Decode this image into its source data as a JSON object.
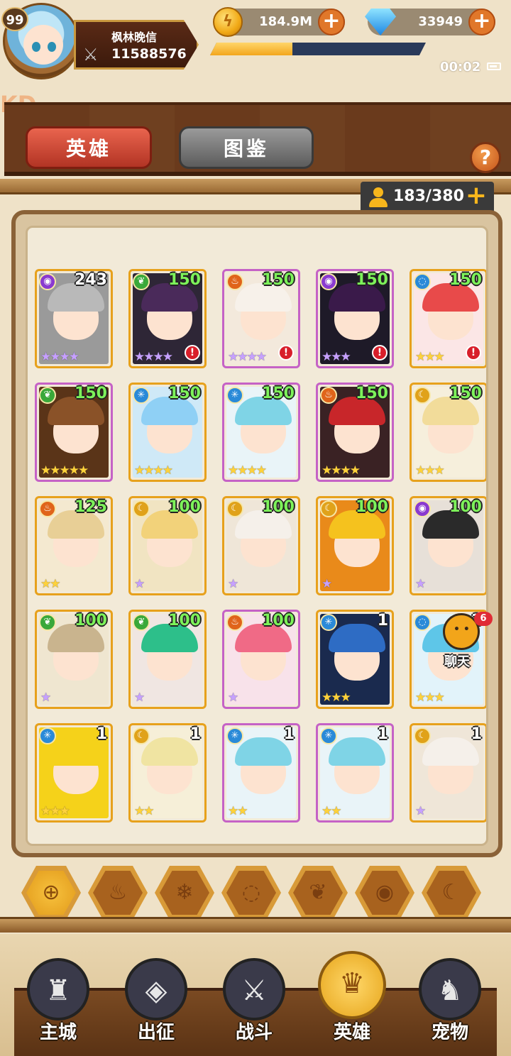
{
  "player": {
    "level": "99",
    "name": "枫林晚信",
    "power": "11588576",
    "xp_fraction": 0.38
  },
  "currencies": {
    "gold": "184.9M",
    "gems": "33949"
  },
  "status": {
    "clock": "00:02"
  },
  "watermark": "KD",
  "tabs": {
    "heroes": "英雄",
    "codex": "图鉴"
  },
  "hero_count": "183/380",
  "chat": {
    "label": "聊天",
    "badge": "6"
  },
  "heroes": [
    {
      "level": "243",
      "element": "dark",
      "stars": 4,
      "star_color": "#c6a0ff",
      "frame": "gold",
      "alert": false,
      "hair": "#b9b9b9",
      "bg": "#9a9a9a"
    },
    {
      "level": "150",
      "element": "nature",
      "stars": 4,
      "star_color": "#c6a0ff",
      "frame": "gold",
      "alert": true,
      "hair": "#4a2a5a",
      "bg": "#2e2636"
    },
    {
      "level": "150",
      "element": "fire",
      "stars": 4,
      "star_color": "#c6a0ff",
      "frame": "purple",
      "alert": true,
      "hair": "#f7f1ea",
      "bg": "#f3e9dc"
    },
    {
      "level": "150",
      "element": "dark",
      "stars": 3,
      "star_color": "#c6a0ff",
      "frame": "purple",
      "alert": true,
      "hair": "#3a1a4a",
      "bg": "#1e1a28"
    },
    {
      "level": "150",
      "element": "water",
      "stars": 3,
      "star_color": "#ffd23a",
      "frame": "gold",
      "alert": true,
      "hair": "#e84a4a",
      "bg": "#fbe6e6"
    },
    {
      "level": "150",
      "element": "nature",
      "stars": 5,
      "star_color": "#ffd23a",
      "frame": "purple",
      "alert": false,
      "hair": "#8a5228",
      "bg": "#5a3418"
    },
    {
      "level": "150",
      "element": "ice",
      "stars": 4,
      "star_color": "#ffd23a",
      "frame": "gold",
      "alert": false,
      "hair": "#8fd0f5",
      "bg": "#cfe9f7"
    },
    {
      "level": "150",
      "element": "ice",
      "stars": 4,
      "star_color": "#ffd23a",
      "frame": "purple",
      "alert": false,
      "hair": "#7fd4e6",
      "bg": "#e9f4f8"
    },
    {
      "level": "150",
      "element": "fire",
      "stars": 4,
      "star_color": "#ffd23a",
      "frame": "purple",
      "alert": false,
      "hair": "#c8262a",
      "bg": "#3a2224"
    },
    {
      "level": "150",
      "element": "light",
      "stars": 3,
      "star_color": "#ffd23a",
      "frame": "gold",
      "alert": false,
      "hair": "#f2dc9a",
      "bg": "#f6efdc"
    },
    {
      "level": "125",
      "element": "fire",
      "stars": 2,
      "star_color": "#ffd23a",
      "frame": "gold",
      "alert": false,
      "hair": "#e8cf96",
      "bg": "#f4e9d0"
    },
    {
      "level": "100",
      "element": "light",
      "stars": 1,
      "star_color": "#c6a0ff",
      "frame": "gold",
      "alert": false,
      "hair": "#f2d27a",
      "bg": "#f1e4c2"
    },
    {
      "level": "100",
      "element": "light",
      "stars": 1,
      "star_color": "#c6a0ff",
      "frame": "gold",
      "alert": false,
      "hair": "#f5f0ea",
      "bg": "#efe6d8"
    },
    {
      "level": "100",
      "element": "light",
      "stars": 1,
      "star_color": "#c6a0ff",
      "frame": "gold",
      "alert": false,
      "hair": "#f5c21e",
      "bg": "#e98a1a"
    },
    {
      "level": "100",
      "element": "dark",
      "stars": 1,
      "star_color": "#c6a0ff",
      "frame": "gold",
      "alert": false,
      "hair": "#2a2a2a",
      "bg": "#e7e0d8"
    },
    {
      "level": "100",
      "element": "nature",
      "stars": 1,
      "star_color": "#c6a0ff",
      "frame": "gold",
      "alert": false,
      "hair": "#c9b48e",
      "bg": "#efe6d0"
    },
    {
      "level": "100",
      "element": "nature",
      "stars": 1,
      "star_color": "#c6a0ff",
      "frame": "gold",
      "alert": false,
      "hair": "#2dbf8a",
      "bg": "#f0e6e2"
    },
    {
      "level": "100",
      "element": "fire",
      "stars": 1,
      "star_color": "#c6a0ff",
      "frame": "purple",
      "alert": false,
      "hair": "#f06a86",
      "bg": "#f8e2ea"
    },
    {
      "level": "1",
      "element": "ice",
      "stars": 3,
      "star_color": "#ffd23a",
      "frame": "gold",
      "alert": false,
      "hair": "#2e6cc4",
      "bg": "#1a2a4e"
    },
    {
      "level": "1",
      "element": "water",
      "stars": 3,
      "star_color": "#ffd23a",
      "frame": "gold",
      "alert": false,
      "hair": "#5ec6e8",
      "bg": "#e2f3fa"
    },
    {
      "level": "1",
      "element": "ice",
      "stars": 3,
      "star_color": "#ffd23a",
      "frame": "gold",
      "alert": false,
      "hair": "#f5d21a",
      "bg": "#f5d21a"
    },
    {
      "level": "1",
      "element": "light",
      "stars": 2,
      "star_color": "#ffd23a",
      "frame": "gold",
      "alert": false,
      "hair": "#f0e4a2",
      "bg": "#f6efd8"
    },
    {
      "level": "1",
      "element": "ice",
      "stars": 2,
      "star_color": "#ffd23a",
      "frame": "purple",
      "alert": false,
      "hair": "#7fd4e6",
      "bg": "#e9f4f8"
    },
    {
      "level": "1",
      "element": "ice",
      "stars": 2,
      "star_color": "#ffd23a",
      "frame": "purple",
      "alert": false,
      "hair": "#7fd4e6",
      "bg": "#e9f4f8"
    },
    {
      "level": "1",
      "element": "light",
      "stars": 1,
      "star_color": "#c6a0ff",
      "frame": "gold",
      "alert": false,
      "hair": "#f5f0ea",
      "bg": "#efe6d8"
    }
  ],
  "element_colors": {
    "dark": "#8a3ad0",
    "nature": "#3aa83a",
    "fire": "#e0641a",
    "water": "#2a8ad8",
    "ice": "#2a8ad8",
    "light": "#e0a21a"
  },
  "element_glyphs": {
    "dark": "◉",
    "nature": "❦",
    "fire": "♨",
    "water": "◌",
    "ice": "✳",
    "light": "☾"
  },
  "filters": [
    {
      "name": "all",
      "glyph": "⊕",
      "active": true
    },
    {
      "name": "fire",
      "glyph": "♨",
      "active": false
    },
    {
      "name": "ice",
      "glyph": "❄",
      "active": false
    },
    {
      "name": "water",
      "glyph": "◌",
      "active": false
    },
    {
      "name": "nature",
      "glyph": "❦",
      "active": false
    },
    {
      "name": "dark",
      "glyph": "◉",
      "active": false
    },
    {
      "name": "light",
      "glyph": "☾",
      "active": false
    }
  ],
  "nav": [
    {
      "label": "主城",
      "icon": "tower-icon",
      "glyph": "♜",
      "active": false
    },
    {
      "label": "出征",
      "icon": "expedition-icon",
      "glyph": "◈",
      "active": false
    },
    {
      "label": "战斗",
      "icon": "battle-icon",
      "glyph": "⚔",
      "active": false
    },
    {
      "label": "英雄",
      "icon": "hero-crest-icon",
      "glyph": "♛",
      "active": true
    },
    {
      "label": "宠物",
      "icon": "dragon-pet-icon",
      "glyph": "♞",
      "active": false
    }
  ]
}
